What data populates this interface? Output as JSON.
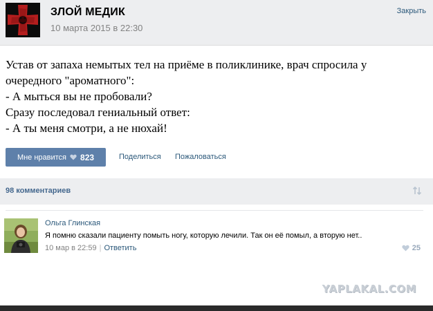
{
  "post": {
    "author": "ЗЛОЙ МЕДИК",
    "date": "10 марта 2015 в 22:30",
    "close_label": "Закрыть",
    "text_lines": [
      "Устав от запаха немытых тел на приёме в поликлинике, врач спросила у",
      "очередного \"ароматного\":",
      "- А мыться вы не пробовали?",
      "Сразу последовал гениальный ответ:",
      "- А ты меня смотри, а не нюхай!"
    ],
    "like_label": "Мне нравится",
    "like_count": "823",
    "share_label": "Поделиться",
    "report_label": "Пожаловаться"
  },
  "comments_section": {
    "count_label": "98 комментариев",
    "sort_icon": "sort-arrows-icon"
  },
  "comment": {
    "author": "Ольга Глинская",
    "text": "Я помню сказали пациенту помыть ногу, которую лечили. Так он её помыл, а вторую нет..",
    "time": "10 мар в 22:59",
    "separator": "|",
    "reply_label": "Ответить",
    "like_count": "25"
  },
  "watermark": "YAPLAKAL.COM",
  "colors": {
    "link": "#2b587a",
    "like_button": "#5e80aa",
    "header_bg": "#edeef0",
    "avatar_cross": "#b41e1e"
  }
}
